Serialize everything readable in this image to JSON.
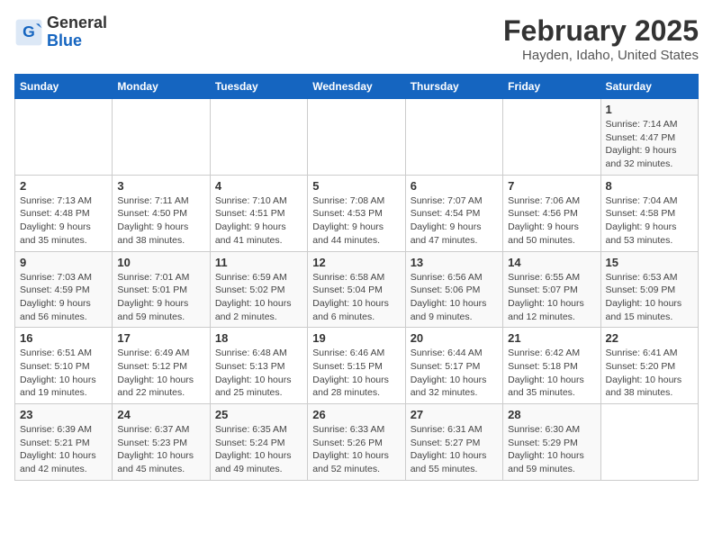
{
  "header": {
    "logo_general": "General",
    "logo_blue": "Blue",
    "month_year": "February 2025",
    "location": "Hayden, Idaho, United States"
  },
  "days_of_week": [
    "Sunday",
    "Monday",
    "Tuesday",
    "Wednesday",
    "Thursday",
    "Friday",
    "Saturday"
  ],
  "weeks": [
    [
      {
        "day": "",
        "info": ""
      },
      {
        "day": "",
        "info": ""
      },
      {
        "day": "",
        "info": ""
      },
      {
        "day": "",
        "info": ""
      },
      {
        "day": "",
        "info": ""
      },
      {
        "day": "",
        "info": ""
      },
      {
        "day": "1",
        "info": "Sunrise: 7:14 AM\nSunset: 4:47 PM\nDaylight: 9 hours and 32 minutes."
      }
    ],
    [
      {
        "day": "2",
        "info": "Sunrise: 7:13 AM\nSunset: 4:48 PM\nDaylight: 9 hours and 35 minutes."
      },
      {
        "day": "3",
        "info": "Sunrise: 7:11 AM\nSunset: 4:50 PM\nDaylight: 9 hours and 38 minutes."
      },
      {
        "day": "4",
        "info": "Sunrise: 7:10 AM\nSunset: 4:51 PM\nDaylight: 9 hours and 41 minutes."
      },
      {
        "day": "5",
        "info": "Sunrise: 7:08 AM\nSunset: 4:53 PM\nDaylight: 9 hours and 44 minutes."
      },
      {
        "day": "6",
        "info": "Sunrise: 7:07 AM\nSunset: 4:54 PM\nDaylight: 9 hours and 47 minutes."
      },
      {
        "day": "7",
        "info": "Sunrise: 7:06 AM\nSunset: 4:56 PM\nDaylight: 9 hours and 50 minutes."
      },
      {
        "day": "8",
        "info": "Sunrise: 7:04 AM\nSunset: 4:58 PM\nDaylight: 9 hours and 53 minutes."
      }
    ],
    [
      {
        "day": "9",
        "info": "Sunrise: 7:03 AM\nSunset: 4:59 PM\nDaylight: 9 hours and 56 minutes."
      },
      {
        "day": "10",
        "info": "Sunrise: 7:01 AM\nSunset: 5:01 PM\nDaylight: 9 hours and 59 minutes."
      },
      {
        "day": "11",
        "info": "Sunrise: 6:59 AM\nSunset: 5:02 PM\nDaylight: 10 hours and 2 minutes."
      },
      {
        "day": "12",
        "info": "Sunrise: 6:58 AM\nSunset: 5:04 PM\nDaylight: 10 hours and 6 minutes."
      },
      {
        "day": "13",
        "info": "Sunrise: 6:56 AM\nSunset: 5:06 PM\nDaylight: 10 hours and 9 minutes."
      },
      {
        "day": "14",
        "info": "Sunrise: 6:55 AM\nSunset: 5:07 PM\nDaylight: 10 hours and 12 minutes."
      },
      {
        "day": "15",
        "info": "Sunrise: 6:53 AM\nSunset: 5:09 PM\nDaylight: 10 hours and 15 minutes."
      }
    ],
    [
      {
        "day": "16",
        "info": "Sunrise: 6:51 AM\nSunset: 5:10 PM\nDaylight: 10 hours and 19 minutes."
      },
      {
        "day": "17",
        "info": "Sunrise: 6:49 AM\nSunset: 5:12 PM\nDaylight: 10 hours and 22 minutes."
      },
      {
        "day": "18",
        "info": "Sunrise: 6:48 AM\nSunset: 5:13 PM\nDaylight: 10 hours and 25 minutes."
      },
      {
        "day": "19",
        "info": "Sunrise: 6:46 AM\nSunset: 5:15 PM\nDaylight: 10 hours and 28 minutes."
      },
      {
        "day": "20",
        "info": "Sunrise: 6:44 AM\nSunset: 5:17 PM\nDaylight: 10 hours and 32 minutes."
      },
      {
        "day": "21",
        "info": "Sunrise: 6:42 AM\nSunset: 5:18 PM\nDaylight: 10 hours and 35 minutes."
      },
      {
        "day": "22",
        "info": "Sunrise: 6:41 AM\nSunset: 5:20 PM\nDaylight: 10 hours and 38 minutes."
      }
    ],
    [
      {
        "day": "23",
        "info": "Sunrise: 6:39 AM\nSunset: 5:21 PM\nDaylight: 10 hours and 42 minutes."
      },
      {
        "day": "24",
        "info": "Sunrise: 6:37 AM\nSunset: 5:23 PM\nDaylight: 10 hours and 45 minutes."
      },
      {
        "day": "25",
        "info": "Sunrise: 6:35 AM\nSunset: 5:24 PM\nDaylight: 10 hours and 49 minutes."
      },
      {
        "day": "26",
        "info": "Sunrise: 6:33 AM\nSunset: 5:26 PM\nDaylight: 10 hours and 52 minutes."
      },
      {
        "day": "27",
        "info": "Sunrise: 6:31 AM\nSunset: 5:27 PM\nDaylight: 10 hours and 55 minutes."
      },
      {
        "day": "28",
        "info": "Sunrise: 6:30 AM\nSunset: 5:29 PM\nDaylight: 10 hours and 59 minutes."
      },
      {
        "day": "",
        "info": ""
      }
    ]
  ]
}
